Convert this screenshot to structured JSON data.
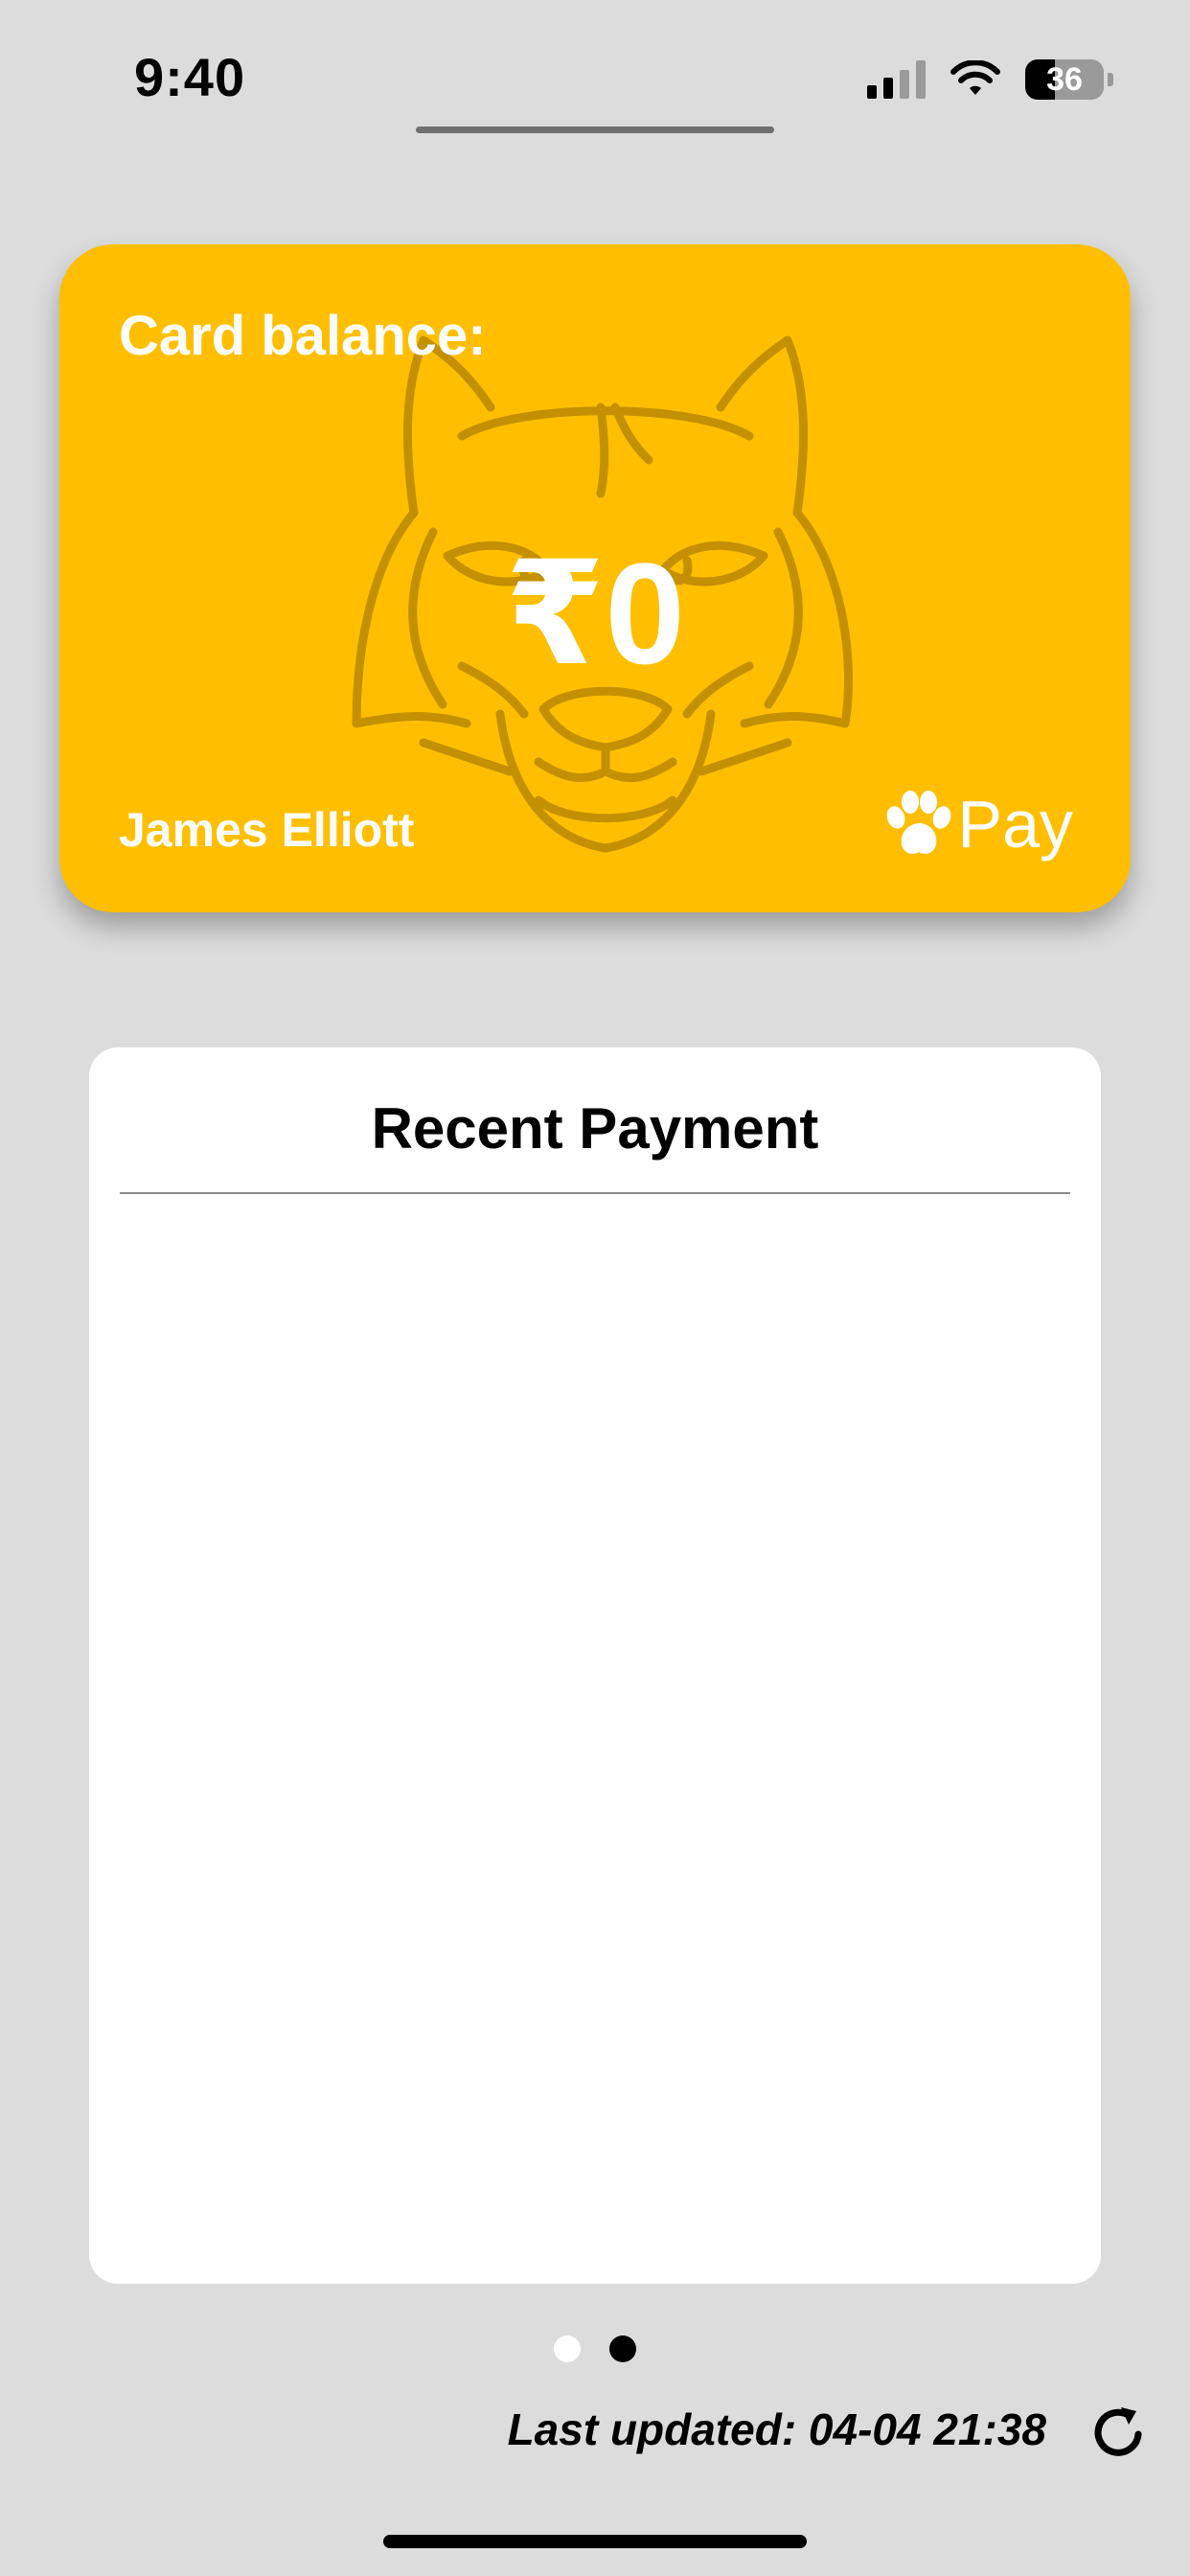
{
  "status_bar": {
    "time": "9:40",
    "battery_level": "36",
    "icons": [
      "signal-icon",
      "wifi-icon",
      "battery-icon"
    ]
  },
  "card": {
    "label": "Card balance:",
    "balance": "₹0",
    "holder_name": "James Elliott",
    "brand_text": "Pay",
    "brand_icon": "paw-icon",
    "background_icon": "tiger-face-icon",
    "color": "#ffbf00"
  },
  "recent_payment": {
    "title": "Recent Payment",
    "items": []
  },
  "pager": {
    "page_count": 2,
    "active_index": 1
  },
  "footer": {
    "last_updated": "Last updated: 04-04 21:38",
    "refresh_icon": "refresh-icon"
  }
}
